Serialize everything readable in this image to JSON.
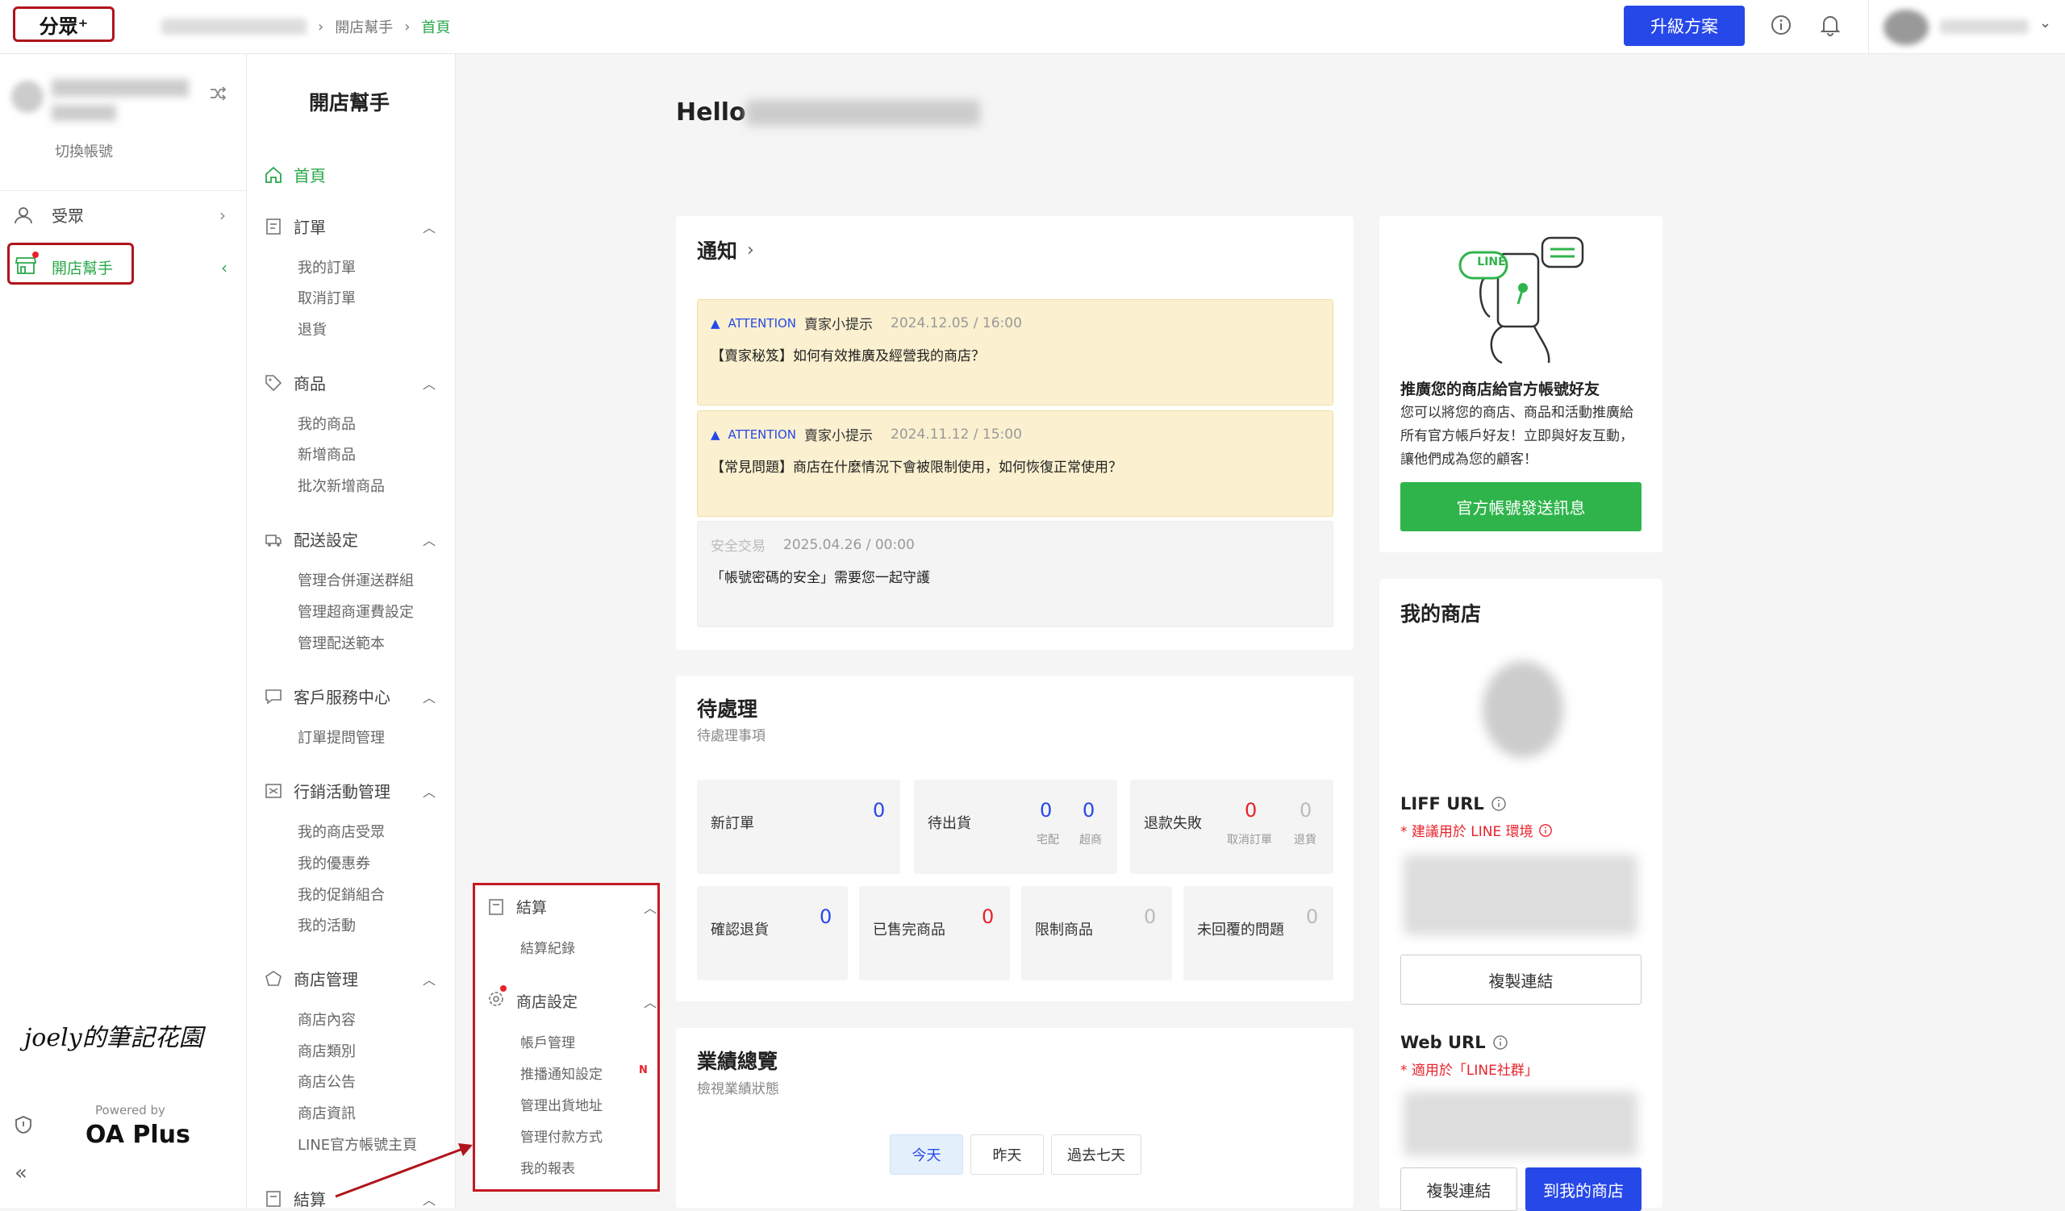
{
  "topbar": {
    "logo": "分眾⁺",
    "breadcrumb": [
      "開店幫手",
      "首頁"
    ],
    "upgrade_label": "升級方案",
    "info_icon": "info-icon",
    "bell_icon": "bell-icon"
  },
  "rail": {
    "switch_account": "切換帳號",
    "items": [
      {
        "label": "受眾",
        "icon": "user-icon"
      },
      {
        "label": "開店幫手",
        "icon": "store-icon"
      }
    ],
    "powered_by": "Powered by",
    "brand": "OA Plus",
    "watermark": "joely的筆記花園"
  },
  "menu": {
    "title": "開店幫手",
    "home": "首頁",
    "sections": [
      {
        "label": "訂單",
        "items": [
          "我的訂單",
          "取消訂單",
          "退貨"
        ]
      },
      {
        "label": "商品",
        "items": [
          "我的商品",
          "新增商品",
          "批次新增商品"
        ]
      },
      {
        "label": "配送設定",
        "items": [
          "管理合併運送群組",
          "管理超商運費設定",
          "管理配送範本"
        ]
      },
      {
        "label": "客戶服務中心",
        "items": [
          "訂單提問管理"
        ]
      },
      {
        "label": "行銷活動管理",
        "items": [
          "我的商店受眾",
          "我的優惠券",
          "我的促銷組合",
          "我的活動"
        ]
      },
      {
        "label": "商店管理",
        "items": [
          "商店內容",
          "商店類別",
          "商店公告",
          "商店資訊",
          "LINE官方帳號主頁"
        ]
      },
      {
        "label": "結算",
        "items": []
      }
    ]
  },
  "floating_panel": {
    "sections": [
      {
        "label": "結算",
        "items": [
          "結算紀錄"
        ]
      },
      {
        "label": "商店設定",
        "items": [
          "帳戶管理",
          "推播通知設定",
          "管理出貨地址",
          "管理付款方式",
          "我的報表"
        ]
      }
    ],
    "new_badge": "N"
  },
  "main": {
    "hello": "Hello",
    "notifications": {
      "title": "通知",
      "items": [
        {
          "tag": "ATTENTION",
          "source": "賣家小提示",
          "date": "2024.12.05 / 16:00",
          "text": "【賣家秘笈】如何有效推廣及經營我的商店？"
        },
        {
          "tag": "ATTENTION",
          "source": "賣家小提示",
          "date": "2024.11.12 / 15:00",
          "text": "【常見問題】商店在什麼情況下會被限制使用，如何恢復正常使用？"
        },
        {
          "tag": "",
          "source": "安全交易",
          "date": "2025.04.26 / 00:00",
          "text": "「帳號密碼的安全」需要您一起守護"
        }
      ]
    },
    "pending": {
      "title": "待處理",
      "subtitle": "待處理事項",
      "new_order": {
        "label": "新訂單",
        "value": "0"
      },
      "to_ship": {
        "label": "待出貨",
        "home_value": "0",
        "home_label": "宅配",
        "store_value": "0",
        "store_label": "超商"
      },
      "refund_fail": {
        "label": "退款失敗",
        "cancel_value": "0",
        "cancel_label": "取消訂單",
        "return_value": "0",
        "return_label": "退貨"
      },
      "confirm_return": {
        "label": "確認退貨",
        "value": "0"
      },
      "sold_out": {
        "label": "已售完商品",
        "value": "0"
      },
      "restricted": {
        "label": "限制商品",
        "value": "0"
      },
      "unanswered": {
        "label": "未回覆的問題",
        "value": "0"
      }
    },
    "performance": {
      "title": "業績總覽",
      "subtitle": "檢視業績狀態",
      "tabs": [
        "今天",
        "昨天",
        "過去七天"
      ]
    }
  },
  "side": {
    "promo": {
      "line_label": "LINE",
      "title": "推廣您的商店給官方帳號好友",
      "text": "您可以將您的商店、商品和活動推廣給所有官方帳戶好友！立即與好友互動，讓他們成為您的顧客！",
      "button": "官方帳號發送訊息"
    },
    "mystore": {
      "title": "我的商店",
      "liff_label": "LIFF URL",
      "liff_note": "* 建議用於 LINE 環境",
      "copy_link": "複製連結",
      "web_label": "Web URL",
      "web_note": "* 適用於「LINE社群」",
      "copy_link2": "複製連結",
      "go_store": "到我的商店"
    }
  },
  "colors": {
    "brand_green": "#2fb44b",
    "primary_blue": "#2748e8",
    "highlight_red": "#b0141c"
  }
}
